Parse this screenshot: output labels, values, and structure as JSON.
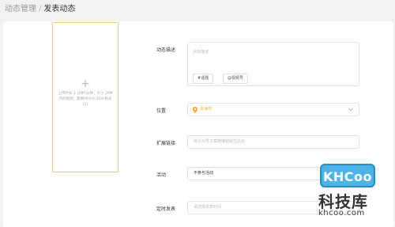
{
  "breadcrumb": {
    "parent": "动态管理",
    "separator": "/",
    "current": "发表动态"
  },
  "uploader": {
    "icon": "plus-icon",
    "hint": "上传时长 1 分钟5分钟，大小 20M 内的视频，需要MP4(H.264)格式(1)"
  },
  "form": {
    "desc_label": "动态描述",
    "desc_placeholder": "添加描述",
    "chips": [
      "#话题",
      "@视频号"
    ],
    "location_label": "位置",
    "location_value": "青海市",
    "ext_link_label": "扩展链接",
    "ext_link_placeholder": "将公众号文章链接粘贴在此处",
    "activity_label": "活动",
    "activity_value": "不参与活动",
    "schedule_label": "定时发表",
    "schedule_placeholder": "请选择发表时间"
  },
  "watermark": {
    "logo_text": "KHCoo",
    "cn_text": "科技库",
    "domain_text": "khcoo.com"
  },
  "colors": {
    "background": "#f2f2f2",
    "card": "#ffffff",
    "uploader_border": "#f0c68a",
    "location_accent": "#f7a744",
    "watermark_blue": "#4fb3e8"
  }
}
